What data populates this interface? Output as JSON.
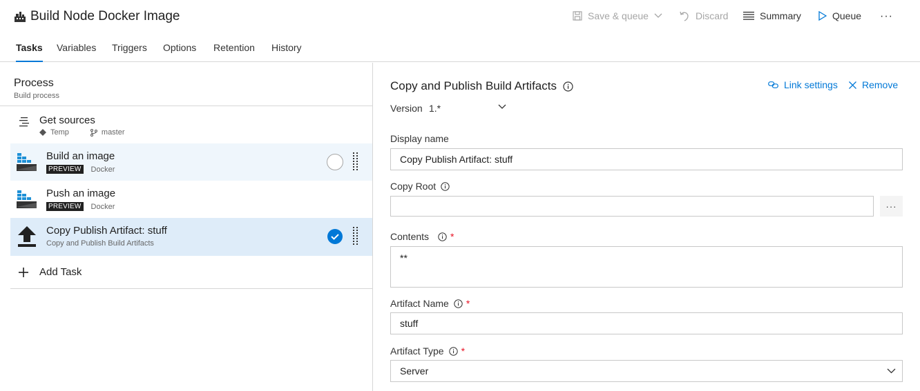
{
  "header": {
    "title": "Build Node Docker Image",
    "toolbar": {
      "save_queue": "Save & queue",
      "discard": "Discard",
      "summary": "Summary",
      "queue": "Queue",
      "more": "···"
    }
  },
  "tabs": [
    "Tasks",
    "Variables",
    "Triggers",
    "Options",
    "Retention",
    "History"
  ],
  "process": {
    "title": "Process",
    "subtitle": "Build process"
  },
  "tasks": [
    {
      "name": "Get sources",
      "repo": "Temp",
      "branch": "master",
      "icon": "get-sources-icon"
    },
    {
      "name": "Build an image",
      "badge": "PREVIEW",
      "sub": "Docker",
      "icon": "docker-icon"
    },
    {
      "name": "Push an image",
      "badge": "PREVIEW",
      "sub": "Docker",
      "icon": "docker-icon"
    },
    {
      "name": "Copy Publish Artifact: stuff",
      "sub": "Copy and Publish Build Artifacts",
      "icon": "upload-icon"
    }
  ],
  "add_task": "Add Task",
  "detail": {
    "title": "Copy and Publish Build Artifacts",
    "link_settings": "Link settings",
    "remove": "Remove",
    "version_label": "Version",
    "version_value": "1.*",
    "fields": {
      "display_name": {
        "label": "Display name",
        "value": "Copy Publish Artifact: stuff"
      },
      "copy_root": {
        "label": "Copy Root",
        "value": ""
      },
      "contents": {
        "label": "Contents",
        "value": "**"
      },
      "artifact_name": {
        "label": "Artifact Name",
        "value": "stuff"
      },
      "artifact_type": {
        "label": "Artifact Type",
        "value": "Server"
      }
    },
    "required_mark": "*",
    "browse": "···"
  },
  "colors": {
    "accent": "#0078d7",
    "selected_row": "#deecf9",
    "hover_row": "#eff6fc",
    "required": "#e81123"
  }
}
